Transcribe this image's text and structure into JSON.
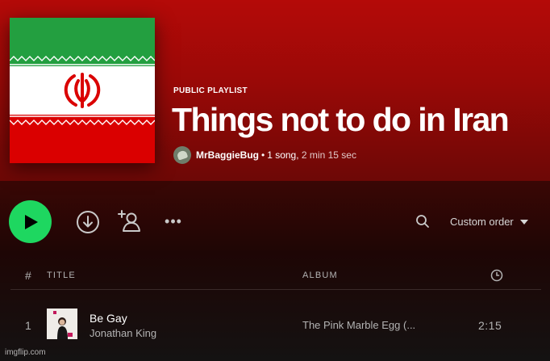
{
  "playlist": {
    "type_label": "PUBLIC PLAYLIST",
    "title": "Things not to do in Iran",
    "owner": "MrBaggieBug",
    "separator": "•",
    "song_count": "1 song,",
    "duration": "2 min 15 sec",
    "cover_image": "Flag of Iran",
    "colors": {
      "accent_green": "#1ed760",
      "hero_red": "#b40a08",
      "flag_green": "#239f40",
      "flag_red": "#da0000"
    }
  },
  "actions": {
    "play_icon": "play-icon",
    "download_icon": "download-icon",
    "add_user_icon": "add-user-icon",
    "more_label": "•••",
    "search_icon": "search-icon",
    "sort_label": "Custom order",
    "sort_icon": "caret-down-icon"
  },
  "table": {
    "headers": {
      "number": "#",
      "title": "TITLE",
      "album": "ALBUM",
      "duration_icon": "clock-icon"
    },
    "rows": [
      {
        "number": "1",
        "title": "Be Gay",
        "artist": "Jonathan King",
        "album": "The Pink Marble Egg (...",
        "duration": "2:15"
      }
    ]
  },
  "watermark": "imgflip.com"
}
